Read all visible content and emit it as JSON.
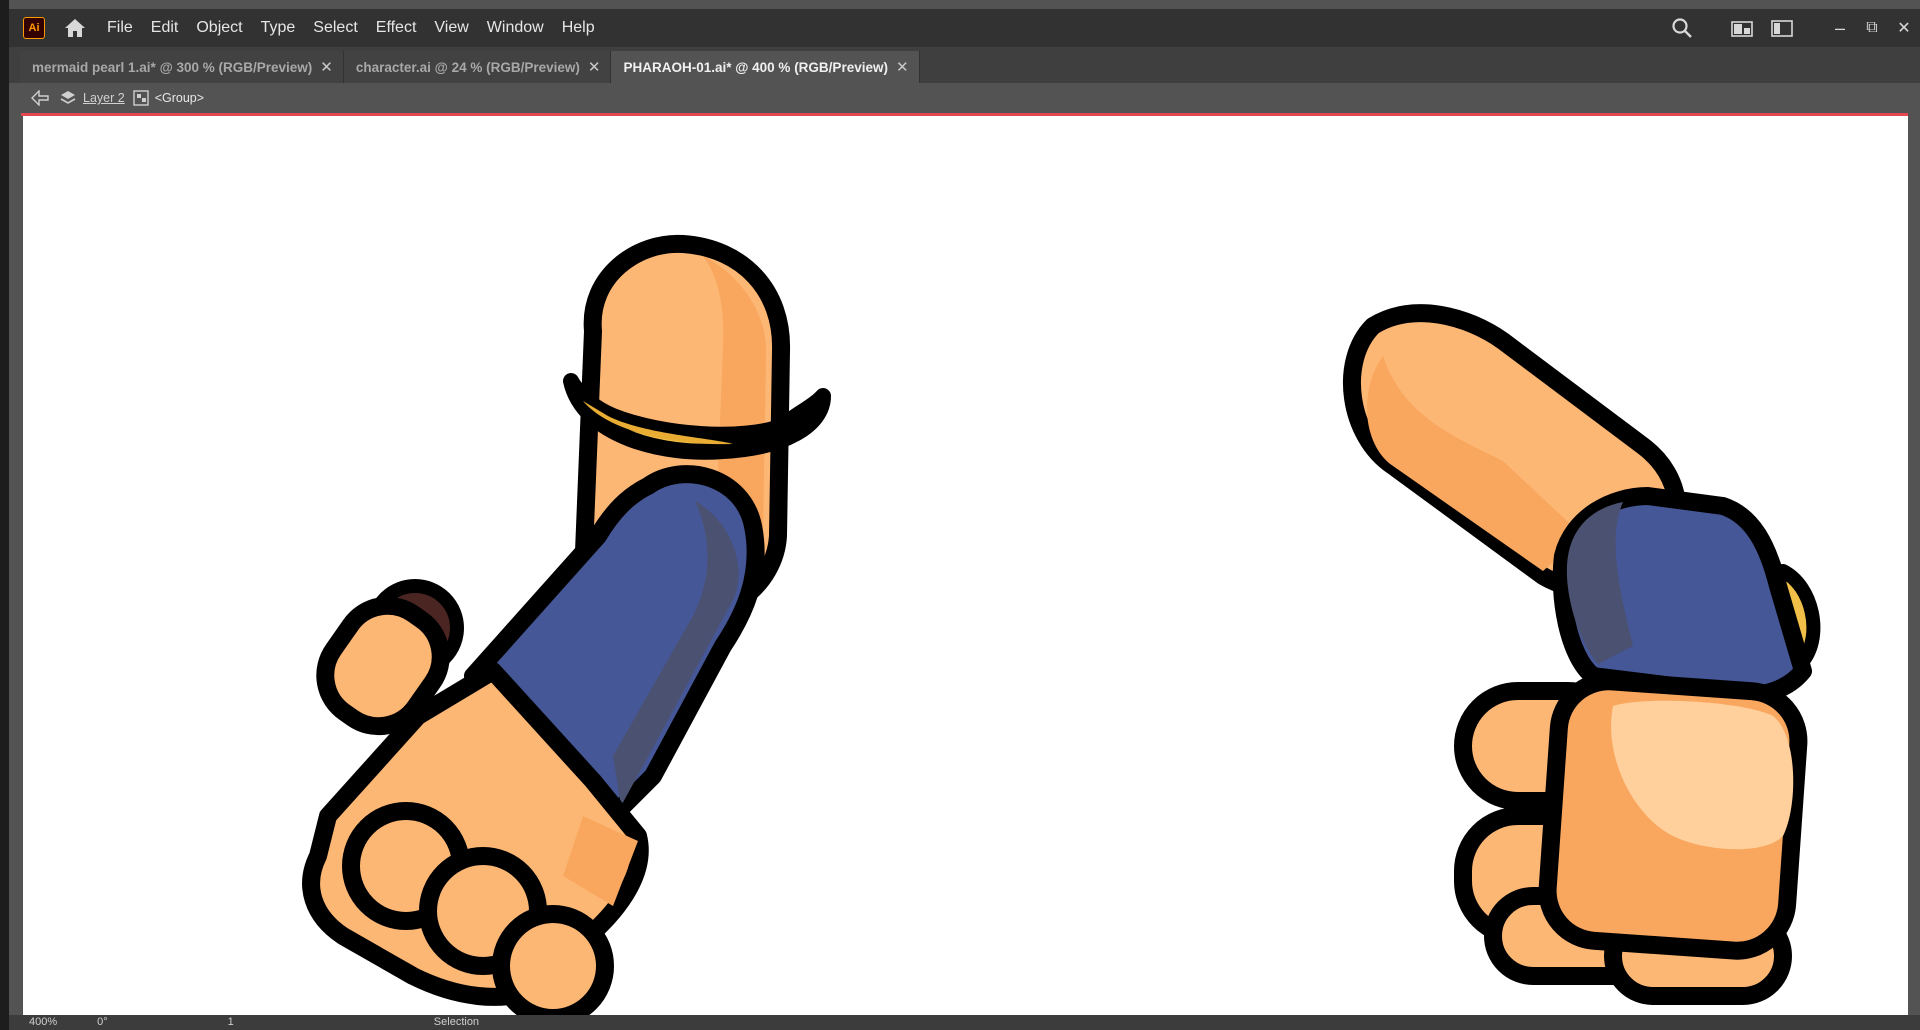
{
  "app": {
    "logo_text": "Ai",
    "logo_color": "#ff9a00"
  },
  "menu": {
    "items": [
      "File",
      "Edit",
      "Object",
      "Type",
      "Select",
      "Effect",
      "View",
      "Window",
      "Help"
    ]
  },
  "window_controls": {
    "search": "search-icon",
    "arrange": "arrange-documents-icon",
    "workspace": "workspace-icon",
    "minimize": "–",
    "restore": "⧉",
    "close": "✕"
  },
  "tabs": [
    {
      "label": "mermaid pearl 1.ai* @ 300 % (RGB/Preview)",
      "close": "✕",
      "active": false
    },
    {
      "label": "character.ai @ 24 % (RGB/Preview)",
      "close": "✕",
      "active": false
    },
    {
      "label": "PHARAOH-01.ai* @ 400 % (RGB/Preview)",
      "close": "✕",
      "active": true
    }
  ],
  "breadcrumb": {
    "layer": "Layer 2",
    "group": "<Group>"
  },
  "isolation_mode_color": "#e34850",
  "artwork": {
    "skin_light": "#fdb775",
    "skin_dark": "#f9a75e",
    "sleeve_blue": "#465797",
    "sleeve_shade": "#4b5170",
    "band_gold": "#f2c048",
    "band_dark": "#e9ad34",
    "outline": "#000000",
    "hair_brown": "#4a2521"
  },
  "status": {
    "zoom": "400%",
    "rotation": "0°",
    "artboard": "1",
    "tool": "Selection"
  }
}
